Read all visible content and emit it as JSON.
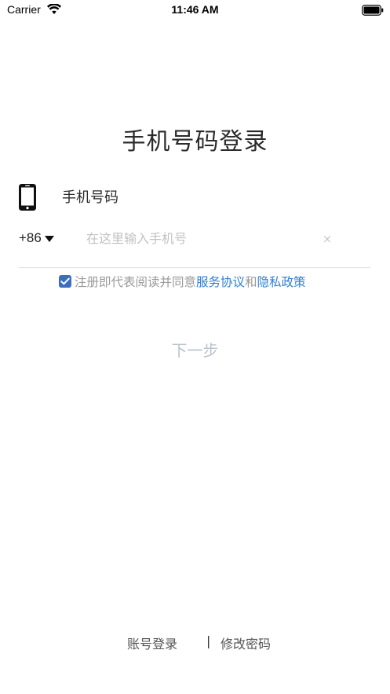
{
  "status_bar": {
    "carrier": "Carrier",
    "time": "11:46 AM"
  },
  "page": {
    "title": "手机号码登录"
  },
  "phone_field": {
    "label": "手机号码",
    "country_code": "+86",
    "placeholder": "在这里输入手机号",
    "value": "",
    "clear_symbol": "×"
  },
  "agreement": {
    "checked": true,
    "prefix": "注册即代表阅读并同意",
    "service_link": "服务协议",
    "conjunction": "和",
    "privacy_link": "隐私政策"
  },
  "next_button": {
    "label": "下一步"
  },
  "footer": {
    "account_login": "账号登录",
    "separator": "|",
    "change_password": "修改密码"
  },
  "colors": {
    "accent": "#2f7fd3",
    "checkbox": "#3a6fbf",
    "disabled_button": "#b9c3cc"
  },
  "icons": [
    "wifi-icon",
    "battery-icon",
    "phone-icon",
    "caret-down-icon",
    "clear-icon",
    "checkbox-icon"
  ]
}
